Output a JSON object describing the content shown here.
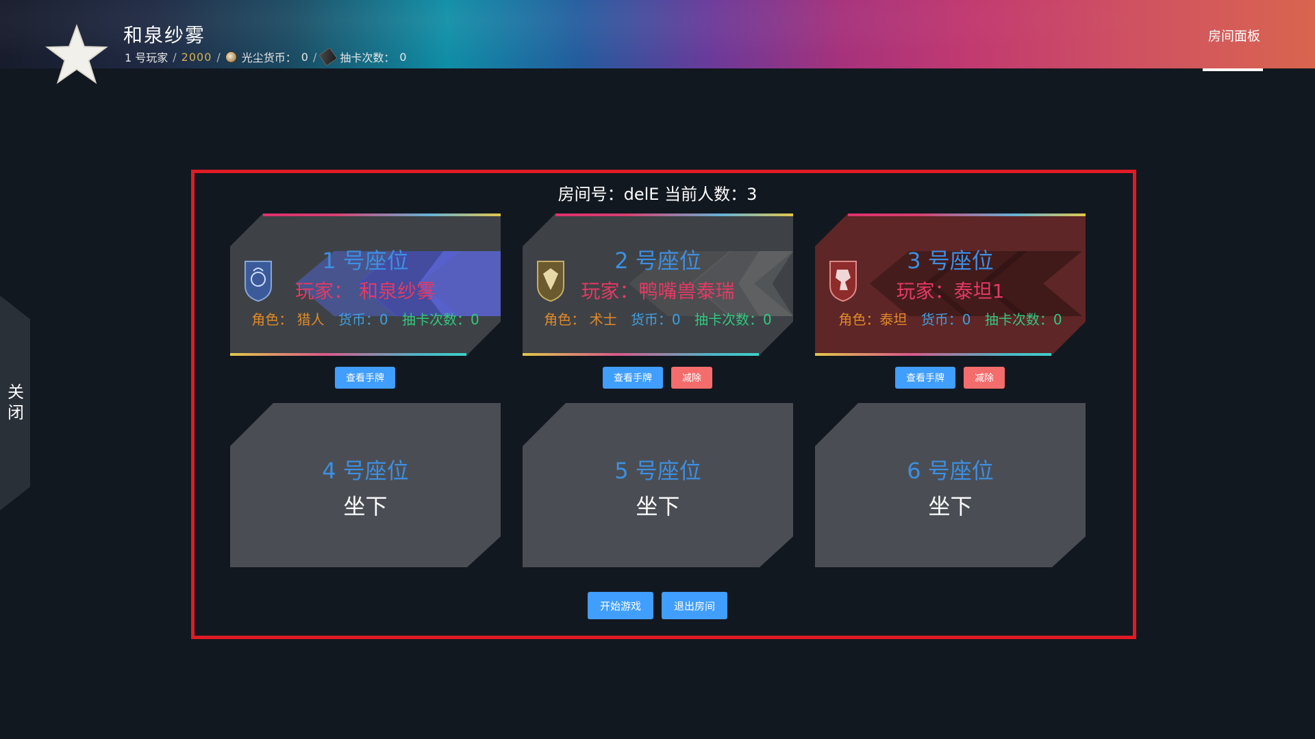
{
  "header": {
    "player_name": "和泉纱雾",
    "player_index": "1 号玩家",
    "score": "2000",
    "dust_label": "光尘货币：",
    "dust_value": "0",
    "draw_label": "抽卡次数：",
    "draw_value": "0",
    "room_panel": "房间面板"
  },
  "side": {
    "close_label": "关\n闭"
  },
  "room": {
    "title": "房间号：delE 当前人数：3",
    "seats": [
      {
        "number": "1 号座位",
        "player": "玩家： 和泉纱雾",
        "role": "角色： 猎人",
        "coin": "货币：0",
        "draws": "抽卡次数：0",
        "view_hand": "查看手牌"
      },
      {
        "number": "2 号座位",
        "player": "玩家：鸭嘴兽泰瑞",
        "role": "角色： 术士",
        "coin": "货币：0",
        "draws": "抽卡次数：0",
        "view_hand": "查看手牌",
        "remove": "减除"
      },
      {
        "number": "3 号座位",
        "player": "玩家：泰坦1",
        "role": "角色：泰坦",
        "coin": "货币：0",
        "draws": "抽卡次数：0",
        "view_hand": "查看手牌",
        "remove": "减除"
      }
    ],
    "empty_seats": [
      {
        "number": "4 号座位",
        "action": "坐下"
      },
      {
        "number": "5 号座位",
        "action": "坐下"
      },
      {
        "number": "6 号座位",
        "action": "坐下"
      }
    ],
    "start_game": "开始游戏",
    "leave_room": "退出房间"
  },
  "colors": {
    "seat_number": "#3d8fe2",
    "player_name": "#e33a64",
    "role": "#e08a2a",
    "coin": "#3fa0e2",
    "draws": "#31c981",
    "button_primary": "#409eff",
    "button_danger": "#f56c6c",
    "frame": "#e01b24"
  },
  "icons": {
    "emblem": "star-emblem-icon",
    "dust": "dust-coin-icon",
    "draw": "card-icon",
    "seat1_class": "hunter-crest-icon",
    "seat2_class": "warlock-crest-icon",
    "seat3_class": "titan-crest-icon"
  }
}
